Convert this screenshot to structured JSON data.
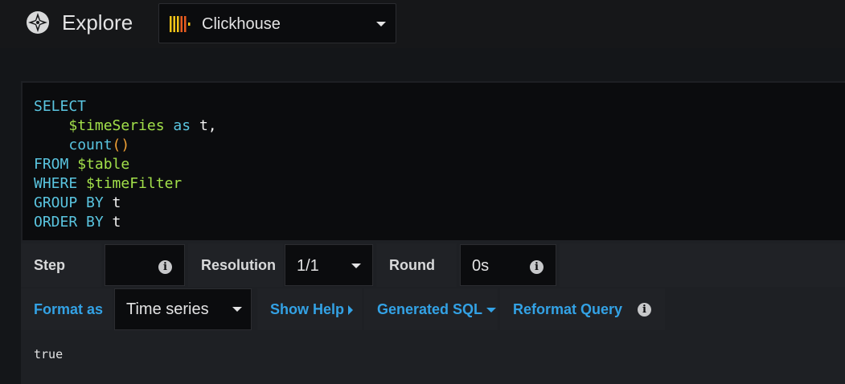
{
  "header": {
    "title": "Explore",
    "datasource": {
      "name": "Clickhouse",
      "icon": "clickhouse-logo-icon"
    }
  },
  "query": {
    "lines": [
      [
        {
          "t": "SELECT",
          "c": "kw"
        }
      ],
      [
        {
          "t": "    ",
          "c": "plain"
        },
        {
          "t": "$timeSeries",
          "c": "var"
        },
        {
          "t": " as ",
          "c": "kw"
        },
        {
          "t": "t,",
          "c": "plain"
        }
      ],
      [
        {
          "t": "    ",
          "c": "plain"
        },
        {
          "t": "count",
          "c": "kw"
        },
        {
          "t": "()",
          "c": "paren"
        }
      ],
      [
        {
          "t": "FROM ",
          "c": "kw"
        },
        {
          "t": "$table",
          "c": "var"
        }
      ],
      [
        {
          "t": "WHERE ",
          "c": "kw"
        },
        {
          "t": "$timeFilter",
          "c": "var"
        }
      ],
      [
        {
          "t": "GROUP BY ",
          "c": "kw"
        },
        {
          "t": "t",
          "c": "plain"
        }
      ],
      [
        {
          "t": "ORDER BY ",
          "c": "kw"
        },
        {
          "t": "t",
          "c": "plain"
        }
      ]
    ]
  },
  "options": {
    "step_label": "Step",
    "step_value": "",
    "resolution_label": "Resolution",
    "resolution_value": "1/1",
    "round_label": "Round",
    "round_value": "0s"
  },
  "toolbar": {
    "format_as_label": "Format as",
    "format_value": "Time series",
    "show_help_label": "Show Help",
    "generated_sql_label": "Generated SQL",
    "reformat_label": "Reformat Query"
  },
  "result": {
    "text": "true"
  },
  "colors": {
    "background": "#141619",
    "panel": "#202226",
    "keyword": "#5ac5e0",
    "variable": "#a2e04a",
    "link": "#33a2e5"
  }
}
